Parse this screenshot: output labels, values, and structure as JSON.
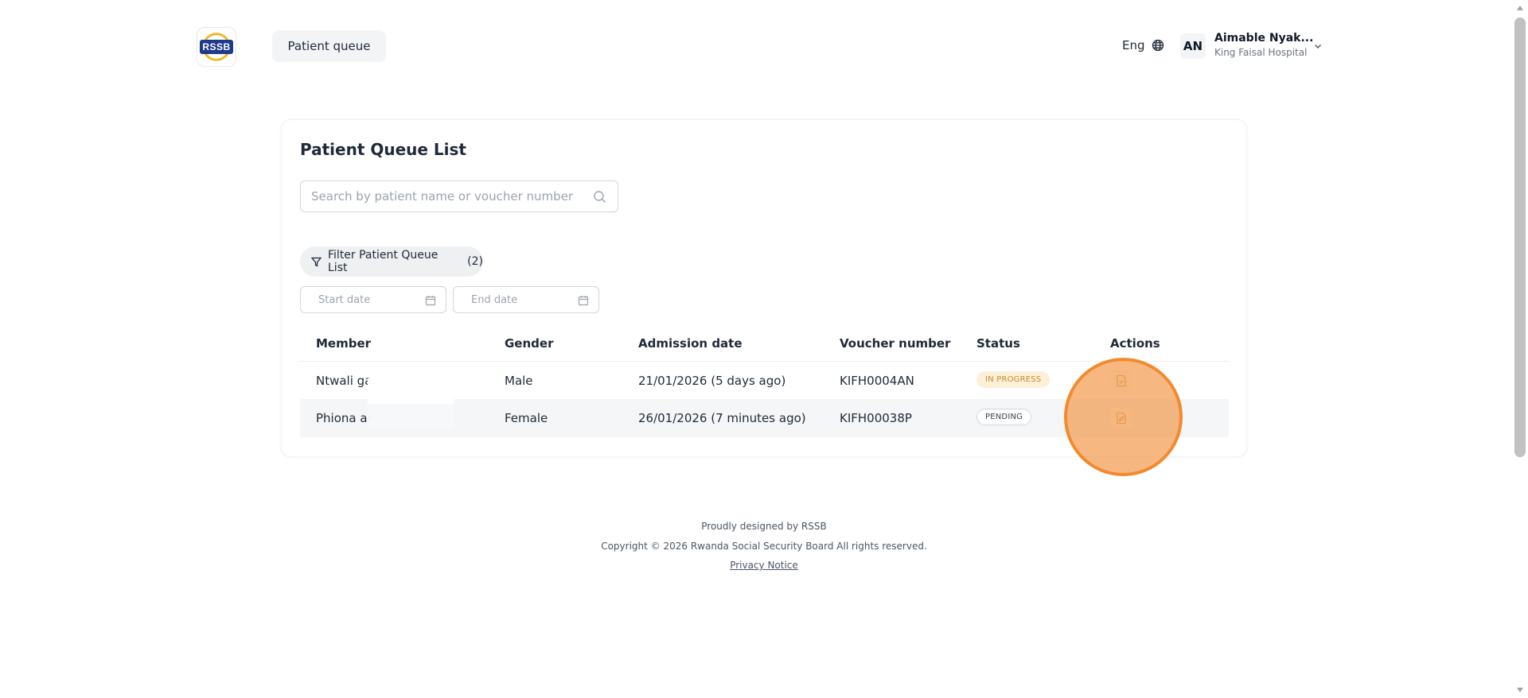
{
  "header": {
    "logo_text": "RSSB",
    "nav_item": "Patient queue",
    "language": "Eng",
    "user": {
      "initials": "AN",
      "name": "Aimable Nyak...",
      "organization": "King Faisal Hospital"
    }
  },
  "queue": {
    "title": "Patient Queue List",
    "search_placeholder": "Search by patient name or voucher number",
    "filter_label": "Filter Patient Queue List",
    "filter_count": "(2)",
    "start_date_placeholder": "Start date",
    "end_date_placeholder": "End date",
    "columns": [
      "Member",
      "Gender",
      "Admission date",
      "Voucher number",
      "Status",
      "Actions"
    ],
    "rows": [
      {
        "member": "Ntwali ga",
        "gender": "Male",
        "admission_date": "21/01/2026 (5 days ago)",
        "voucher": "KIFH0004AN",
        "status": "IN PROGRESS"
      },
      {
        "member": "Phiona ar",
        "gender": "Female",
        "admission_date": "26/01/2026 (7 minutes ago)",
        "voucher": "KIFH00038P",
        "status": "PENDING"
      }
    ]
  },
  "footer": {
    "designed_by": "Proudly designed by RSSB",
    "copyright": "Copyright © 2026 Rwanda Social Security Board All rights reserved.",
    "privacy": "Privacy Notice"
  },
  "colors": {
    "accent_click": "#f28a2e",
    "in_progress_bg": "#fdf0d8",
    "in_progress_text": "#c58a2b",
    "brand_blue": "#1f3a8a"
  }
}
